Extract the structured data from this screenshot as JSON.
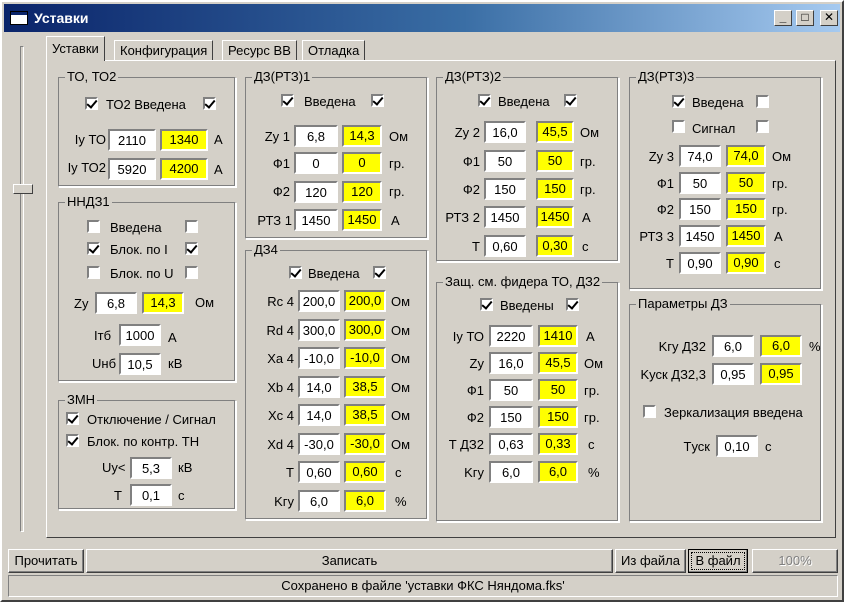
{
  "window": {
    "title": "Уставки",
    "buttons": {
      "minimize": "_",
      "maximize": "□",
      "close": "✕"
    }
  },
  "tabs": [
    "Уставки",
    "Конфигурация",
    "Ресурс ВВ",
    "Отладка"
  ],
  "to": {
    "legend": "ТО, ТО2",
    "enable_label": "ТО2 Введена",
    "rows": [
      {
        "label": "Iу ТО",
        "value": "2110",
        "computed": "1340",
        "unit": "А"
      },
      {
        "label": "Iу ТО2",
        "value": "5920",
        "computed": "4200",
        "unit": "А"
      }
    ]
  },
  "nndz": {
    "legend": "ННДЗ1",
    "checks": [
      {
        "label": "Введена",
        "left": false,
        "right": false
      },
      {
        "label": "Блок. по I",
        "left": true,
        "right": true
      },
      {
        "label": "Блок. по U",
        "left": false,
        "right": false
      }
    ],
    "zy": {
      "label": "Zу",
      "value": "6,8",
      "computed": "14,3",
      "unit": "Ом"
    },
    "itb": {
      "label": "Iтб",
      "value": "1000",
      "unit": "А"
    },
    "unb": {
      "label": "Uнб",
      "value": "10,5",
      "unit": "кВ"
    }
  },
  "zmn": {
    "legend": "ЗМН",
    "checks": [
      "Отключение / Сигнал",
      "Блок. по контр. ТН"
    ],
    "uy": {
      "label": "Uу<",
      "value": "5,3",
      "unit": "кВ"
    },
    "t": {
      "label": "T",
      "value": "0,1",
      "unit": "с"
    }
  },
  "dz1": {
    "legend": "ДЗ(РТЗ)1",
    "enable_label": "Введена",
    "rows": [
      {
        "label": "Zу 1",
        "value": "6,8",
        "computed": "14,3",
        "unit": "Ом"
      },
      {
        "label": "Ф1",
        "value": "0",
        "computed": "0",
        "unit": "гр."
      },
      {
        "label": "Ф2",
        "value": "120",
        "computed": "120",
        "unit": "гр."
      },
      {
        "label": "РТЗ 1",
        "value": "1450",
        "computed": "1450",
        "unit": "А"
      }
    ]
  },
  "dz4": {
    "legend": "ДЗ4",
    "enable_label": "Введена",
    "rows": [
      {
        "label": "Rc 4",
        "value": "200,0",
        "computed": "200,0",
        "unit": "Ом"
      },
      {
        "label": "Rd 4",
        "value": "300,0",
        "computed": "300,0",
        "unit": "Ом"
      },
      {
        "label": "Xa 4",
        "value": "-10,0",
        "computed": "-10,0",
        "unit": "Ом"
      },
      {
        "label": "Xb 4",
        "value": "14,0",
        "computed": "38,5",
        "unit": "Ом"
      },
      {
        "label": "Xc 4",
        "value": "14,0",
        "computed": "38,5",
        "unit": "Ом"
      },
      {
        "label": "Xd 4",
        "value": "-30,0",
        "computed": "-30,0",
        "unit": "Ом"
      },
      {
        "label": "T",
        "value": "0,60",
        "computed": "0,60",
        "unit": "с"
      },
      {
        "label": "Kгу",
        "value": "6,0",
        "computed": "6,0",
        "unit": "%"
      }
    ]
  },
  "dz2": {
    "legend": "ДЗ(РТЗ)2",
    "enable_label": "Введена",
    "rows": [
      {
        "label": "Zу 2",
        "value": "16,0",
        "computed": "45,5",
        "unit": "Ом"
      },
      {
        "label": "Ф1",
        "value": "50",
        "computed": "50",
        "unit": "гр."
      },
      {
        "label": "Ф2",
        "value": "150",
        "computed": "150",
        "unit": "гр."
      },
      {
        "label": "РТЗ 2",
        "value": "1450",
        "computed": "1450",
        "unit": "А"
      },
      {
        "label": "T",
        "value": "0,60",
        "computed": "0,30",
        "unit": "с"
      }
    ]
  },
  "feeder": {
    "legend": "Защ. см. фидера ТО, ДЗ2",
    "enable_label": "Введены",
    "rows": [
      {
        "label": "Iу ТО",
        "value": "2220",
        "computed": "1410",
        "unit": "А"
      },
      {
        "label": "Zу",
        "value": "16,0",
        "computed": "45,5",
        "unit": "Ом"
      },
      {
        "label": "Ф1",
        "value": "50",
        "computed": "50",
        "unit": "гр."
      },
      {
        "label": "Ф2",
        "value": "150",
        "computed": "150",
        "unit": "гр."
      },
      {
        "label": "T ДЗ2",
        "value": "0,63",
        "computed": "0,33",
        "unit": "с"
      },
      {
        "label": "Kгу",
        "value": "6,0",
        "computed": "6,0",
        "unit": "%"
      }
    ]
  },
  "dz3": {
    "legend": "ДЗ(РТЗ)3",
    "enable_label": "Введена",
    "signal_label": "Сигнал",
    "rows": [
      {
        "label": "Zу 3",
        "value": "74,0",
        "computed": "74,0",
        "unit": "Ом"
      },
      {
        "label": "Ф1",
        "value": "50",
        "computed": "50",
        "unit": "гр."
      },
      {
        "label": "Ф2",
        "value": "150",
        "computed": "150",
        "unit": "гр."
      },
      {
        "label": "РТЗ 3",
        "value": "1450",
        "computed": "1450",
        "unit": "А"
      },
      {
        "label": "T",
        "value": "0,90",
        "computed": "0,90",
        "unit": "с"
      }
    ]
  },
  "params": {
    "legend": "Параметры ДЗ",
    "kgu": {
      "label": "Kгу ДЗ2",
      "value": "6,0",
      "computed": "6,0",
      "unit": "%"
    },
    "kusk": {
      "label": "Kуск ДЗ2,3",
      "value": "0,95",
      "computed": "0,95"
    },
    "mirror_label": "Зеркализация введена",
    "tusk": {
      "label": "Tуск",
      "value": "0,10",
      "unit": "с"
    }
  },
  "buttons": {
    "read": "Прочитать",
    "write": "Записать",
    "from_file": "Из файла",
    "to_file": "В файл",
    "progress": "100%"
  },
  "status": "Сохранено в файле 'уставки ФКС Няндома.fks'"
}
